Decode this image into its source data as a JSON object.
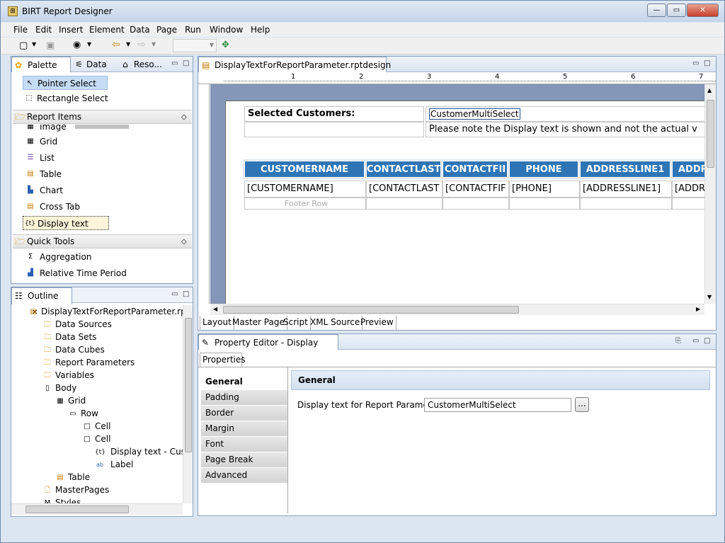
{
  "window": {
    "title": "BIRT Report Designer"
  },
  "menu": [
    "File",
    "Edit",
    "Insert",
    "Element",
    "Data",
    "Page",
    "Run",
    "Window",
    "Help"
  ],
  "palette_panel": {
    "tabs": [
      "Palette",
      "Data ...",
      "Reso..."
    ],
    "tools": [
      "Pointer Select",
      "Rectangle Select"
    ],
    "report_items_label": "Report Items",
    "report_items": [
      "Image",
      "Grid",
      "List",
      "Table",
      "Chart",
      "Cross Tab",
      "Display text"
    ],
    "quick_tools_label": "Quick Tools",
    "quick_tools": [
      "Aggregation",
      "Relative Time Period"
    ]
  },
  "outline_panel": {
    "tab": "Outline",
    "root": "DisplayTextForReportParameter.rptde",
    "nodes": [
      "Data Sources",
      "Data Sets",
      "Data Cubes",
      "Report Parameters",
      "Variables",
      "Body",
      "Grid",
      "Row",
      "Cell",
      "Cell",
      "Display text - Custo",
      "Label",
      "Table",
      "MasterPages",
      "Styles"
    ]
  },
  "editor": {
    "tab": "DisplayTextForReportParameter.rptdesign",
    "ruler_numbers": [
      "1",
      "2",
      "3",
      "4",
      "5",
      "6",
      "7"
    ],
    "grid_label": "Selected Customers:",
    "grid_value": "CustomerMultiSelect",
    "grid_note": "Please note the Display text is shown and not the actual v",
    "table_headers": [
      "CUSTOMERNAME",
      "CONTACTLAST",
      "CONTACTFII",
      "PHONE",
      "ADDRESSLINE1",
      "ADDR"
    ],
    "table_details": [
      "[CUSTOMERNAME]",
      "[CONTACTLAST",
      "[CONTACTFIF",
      "[PHONE]",
      "[ADDRESSLINE1]",
      "[ADDR"
    ],
    "footer_row": "Footer Row",
    "bottom_tabs": [
      "Layout",
      "Master Page",
      "Script",
      "XML Source",
      "Preview"
    ]
  },
  "property_editor": {
    "tab": "Property Editor - Display text",
    "subtab": "Properties",
    "categories": [
      "General",
      "Padding",
      "Border",
      "Margin",
      "Font",
      "Page Break",
      "Advanced"
    ],
    "section_title": "General",
    "field_label": "Display text for Report Parameter:",
    "field_value": "CustomerMultiSelect",
    "browse_label": "..."
  },
  "colors": {
    "header_blue": "#2e75b6",
    "selection": "#c5dcf5"
  }
}
